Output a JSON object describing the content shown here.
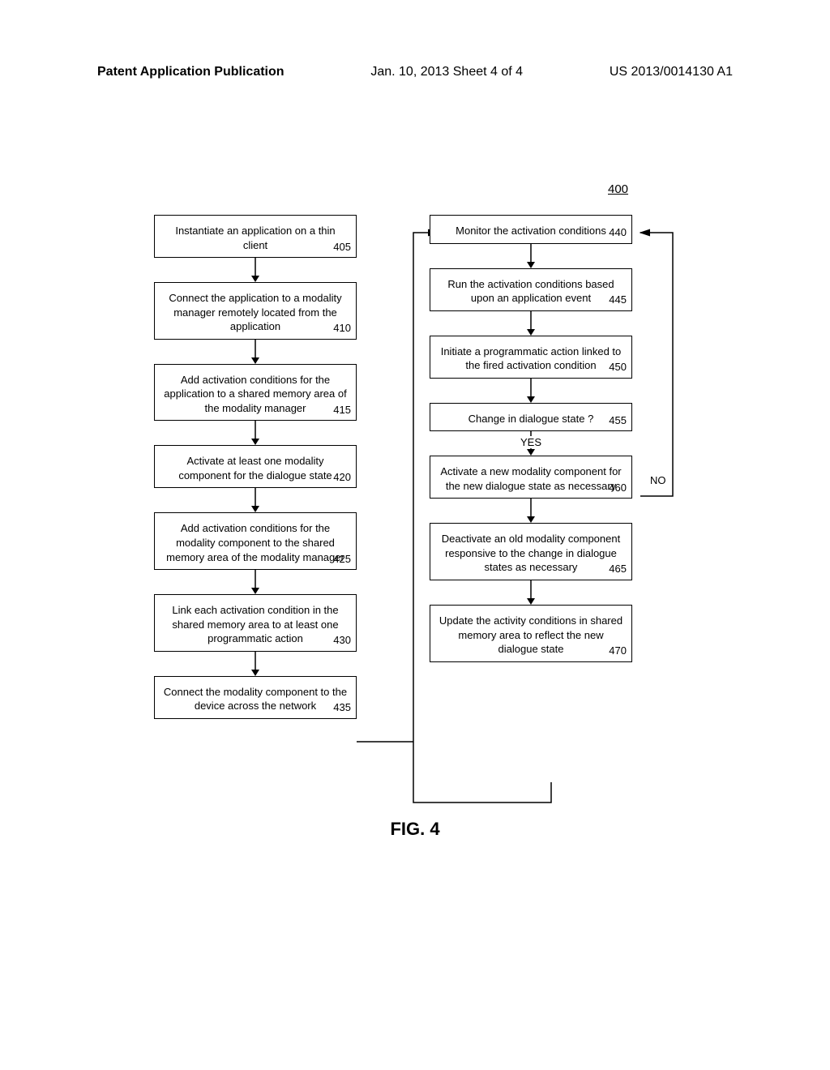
{
  "header": {
    "left": "Patent Application Publication",
    "center": "Jan. 10, 2013   Sheet 4 of 4",
    "right": "US 2013/0014130 A1"
  },
  "figure_ref": "400",
  "figure_caption": "FIG. 4",
  "left_boxes": [
    {
      "text": "Instantiate an application on a thin client",
      "num": "405"
    },
    {
      "text": "Connect the application to a modality manager remotely located from the application",
      "num": "410"
    },
    {
      "text": "Add activation conditions for the application to a shared memory area of the modality manager",
      "num": "415"
    },
    {
      "text": "Activate at least one modality component for the dialogue state",
      "num": "420"
    },
    {
      "text": "Add activation conditions for the modality component to the shared memory area of the modality manager",
      "num": "425"
    },
    {
      "text": "Link each activation condition in the shared memory area to at least one programmatic action",
      "num": "430"
    },
    {
      "text": "Connect the modality component to the device across the network",
      "num": "435"
    }
  ],
  "right_boxes": [
    {
      "text": "Monitor the activation conditions",
      "num": "440"
    },
    {
      "text": "Run the activation conditions based upon an application event",
      "num": "445"
    },
    {
      "text": "Initiate a programmatic action linked to the fired activation condition",
      "num": "450"
    },
    {
      "text": "Change in dialogue state ?",
      "num": "455"
    },
    {
      "text": "Activate a new modality component for the new dialogue state as necessary",
      "num": "460"
    },
    {
      "text": "Deactivate an old modality component responsive to the change in dialogue states as necessary",
      "num": "465"
    },
    {
      "text": "Update the activity conditions in shared memory area to reflect the new dialogue state",
      "num": "470"
    }
  ],
  "decision": {
    "yes": "YES",
    "no": "NO"
  },
  "chart_data": {
    "type": "flowchart",
    "title": "FIG. 4",
    "ref": "400",
    "nodes": [
      {
        "id": "405",
        "label": "Instantiate an application on a thin client"
      },
      {
        "id": "410",
        "label": "Connect the application to a modality manager remotely located from the application"
      },
      {
        "id": "415",
        "label": "Add activation conditions for the application to a shared memory area of the modality manager"
      },
      {
        "id": "420",
        "label": "Activate at least one modality component for the dialogue state"
      },
      {
        "id": "425",
        "label": "Add activation conditions for the modality component to the shared memory area of the modality manager"
      },
      {
        "id": "430",
        "label": "Link each activation condition in the shared memory area to at least one programmatic action"
      },
      {
        "id": "435",
        "label": "Connect the modality component to the device across the network"
      },
      {
        "id": "440",
        "label": "Monitor the activation conditions"
      },
      {
        "id": "445",
        "label": "Run the activation conditions based upon an application event"
      },
      {
        "id": "450",
        "label": "Initiate a programmatic action linked to the fired activation condition"
      },
      {
        "id": "455",
        "label": "Change in dialogue state ?",
        "decision": true
      },
      {
        "id": "460",
        "label": "Activate a new modality component for the new dialogue state as necessary"
      },
      {
        "id": "465",
        "label": "Deactivate an old modality component responsive to the change in dialogue states as necessary"
      },
      {
        "id": "470",
        "label": "Update the activity conditions in shared memory area to reflect the new dialogue state"
      }
    ],
    "edges": [
      {
        "from": "405",
        "to": "410"
      },
      {
        "from": "410",
        "to": "415"
      },
      {
        "from": "415",
        "to": "420"
      },
      {
        "from": "420",
        "to": "425"
      },
      {
        "from": "425",
        "to": "430"
      },
      {
        "from": "430",
        "to": "435"
      },
      {
        "from": "435",
        "to": "440"
      },
      {
        "from": "440",
        "to": "445"
      },
      {
        "from": "445",
        "to": "450"
      },
      {
        "from": "450",
        "to": "455"
      },
      {
        "from": "455",
        "to": "460",
        "label": "YES"
      },
      {
        "from": "455",
        "to": "440",
        "label": "NO"
      },
      {
        "from": "460",
        "to": "465"
      },
      {
        "from": "465",
        "to": "470"
      },
      {
        "from": "470",
        "to": "440"
      }
    ]
  }
}
